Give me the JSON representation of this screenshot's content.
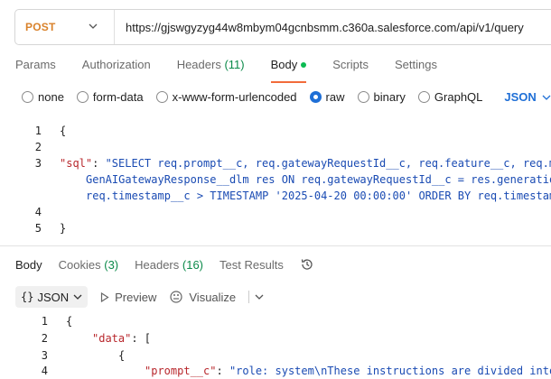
{
  "request": {
    "method": "POST",
    "url": "https://gjswgyzyg44w8mbym04gcnbsmm.c360a.salesforce.com/api/v1/query"
  },
  "req_tabs": [
    {
      "label": "Params",
      "count": "",
      "active": false,
      "dot": false
    },
    {
      "label": "Authorization",
      "count": "",
      "active": false,
      "dot": false
    },
    {
      "label": "Headers",
      "count": "(11)",
      "active": false,
      "dot": false
    },
    {
      "label": "Body",
      "count": "",
      "active": true,
      "dot": true
    },
    {
      "label": "Scripts",
      "count": "",
      "active": false,
      "dot": false
    },
    {
      "label": "Settings",
      "count": "",
      "active": false,
      "dot": false
    }
  ],
  "body_types": [
    {
      "label": "none",
      "checked": false
    },
    {
      "label": "form-data",
      "checked": false
    },
    {
      "label": "x-www-form-urlencoded",
      "checked": false
    },
    {
      "label": "raw",
      "checked": true
    },
    {
      "label": "binary",
      "checked": false
    },
    {
      "label": "GraphQL",
      "checked": false
    }
  ],
  "raw_format": "JSON",
  "request_body": {
    "line_numbers": [
      "1",
      "2",
      "3",
      "",
      "",
      "4",
      "5"
    ],
    "open_brace": "{",
    "sql_key": "\"sql\"",
    "colon": ": ",
    "sql_line1": "\"SELECT req.prompt__c, req.gatewayRequestId__c, req.feature__c, req.m",
    "sql_line2": "GenAIGatewayResponse__dlm res ON req.gatewayRequestId__c = res.generatio",
    "sql_line3": "req.timestamp__c > TIMESTAMP '2025-04-20 00:00:00' ORDER BY req.timestam",
    "close_brace": "}"
  },
  "res_tabs": [
    {
      "label": "Body",
      "count": "",
      "active": true
    },
    {
      "label": "Cookies",
      "count": "(3)",
      "active": false
    },
    {
      "label": "Headers",
      "count": "(16)",
      "active": false
    },
    {
      "label": "Test Results",
      "count": "",
      "active": false
    }
  ],
  "res_toolbar": {
    "format_braces": "{}",
    "format_label": "JSON",
    "preview_label": "Preview",
    "visualize_label": "Visualize"
  },
  "response_body": {
    "line_numbers": [
      "1",
      "2",
      "3",
      "4"
    ],
    "line1": "{",
    "data_key": "\"data\"",
    "data_open": ": [",
    "line3": "{",
    "prompt_key": "\"prompt__c\"",
    "prompt_value": "\"role: system\\nThese instructions are divided into"
  },
  "colors": {
    "method": "#d9822b",
    "accent_tab": "#f26b3a",
    "radio": "#1f6fd6",
    "json_key": "#b8272c",
    "json_string": "#1a4bb3",
    "count_green": "#0c8a4a"
  }
}
